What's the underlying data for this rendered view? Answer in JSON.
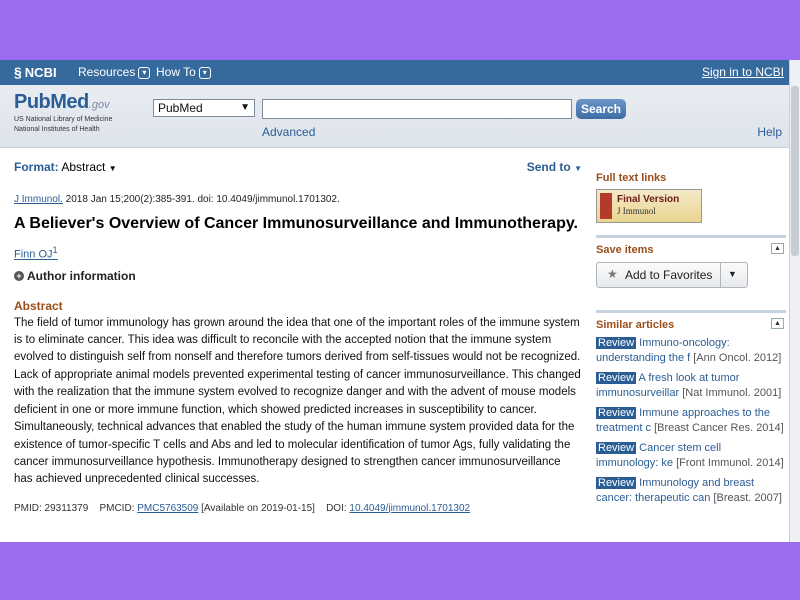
{
  "ncbi_bar": {
    "logo": "NCBI",
    "resources": "Resources",
    "howto": "How To",
    "signin": "Sign in to NCBI"
  },
  "search": {
    "logo_main": "PubMed",
    "logo_gov": ".gov",
    "logo_sub1": "US National Library of Medicine",
    "logo_sub2": "National Institutes of Health",
    "db_selected": "PubMed",
    "query": "",
    "button": "Search",
    "advanced": "Advanced",
    "help": "Help"
  },
  "toolbar": {
    "format_label": "Format:",
    "format_value": "Abstract",
    "send_to": "Send to"
  },
  "article": {
    "journal": "J Immunol.",
    "citation_rest": " 2018 Jan 15;200(2):385-391. doi: 10.4049/jimmunol.1701302.",
    "title": "A Believer's Overview of Cancer Immunosurveillance and Immunotherapy.",
    "author": "Finn OJ",
    "author_sup": "1",
    "author_info": "Author information",
    "abstract_heading": "Abstract",
    "abstract": "The field of tumor immunology has grown around the idea that one of the important roles of the immune system is to eliminate cancer. This idea was difficult to reconcile with the accepted notion that the immune system evolved to distinguish self from nonself and therefore tumors derived from self-tissues would not be recognized. Lack of appropriate animal models prevented experimental testing of cancer immunosurveillance. This changed with the realization that the immune system evolved to recognize danger and with the advent of mouse models deficient in one or more immune function, which showed predicted increases in susceptibility to cancer. Simultaneously, technical advances that enabled the study of the human immune system provided data for the existence of tumor-specific T cells and Abs and led to molecular identification of tumor Ags, fully validating the cancer immunosurveillance hypothesis. Immunotherapy designed to strengthen cancer immunosurveillance has achieved unprecedented clinical successes.",
    "pmid_label": "PMID: 29311379",
    "pmcid_label": "PMCID:",
    "pmcid": "PMC5763509",
    "pmcid_note": "[Available on 2019-01-15]",
    "doi_label": "DOI:",
    "doi": "10.4049/jimmunol.1701302"
  },
  "sidebar": {
    "fulltext_heading": "Full text links",
    "badge_main": "Final Version",
    "badge_sub": "J Immunol",
    "save_heading": "Save items",
    "add_favorites": "Add to Favorites",
    "similar_heading": "Similar articles",
    "similar": [
      {
        "tag": "Review",
        "title": "Immuno-oncology: understanding the f",
        "source": "[Ann Oncol. 2012]"
      },
      {
        "tag": "Review",
        "title": "A fresh look at tumor immunosurveillar",
        "source": "[Nat Immunol. 2001]"
      },
      {
        "tag": "Review",
        "title": "Immune approaches to the treatment c",
        "source": "[Breast Cancer Res. 2014]"
      },
      {
        "tag": "Review",
        "title": "Cancer stem cell immunology: ke",
        "source": "[Front Immunol. 2014]"
      },
      {
        "tag": "Review",
        "title": "Immunology and breast cancer: therapeutic can",
        "source": "[Breast. 2007]"
      }
    ]
  },
  "colors": {
    "ncbi_bar": "#366a9d",
    "link": "#2b5d95",
    "heading_accent": "#9b4d1a",
    "backdrop": "#9b6cf0"
  }
}
